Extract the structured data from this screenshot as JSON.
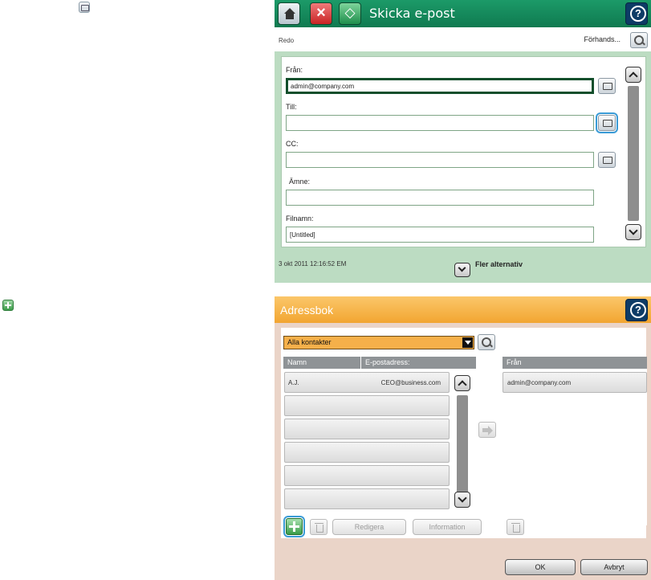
{
  "email": {
    "title": "Skicka e-post",
    "status": "Redo",
    "preview_label": "Förhands...",
    "from_label": "Från:",
    "from_value": "admin@company.com",
    "to_label": "Till:",
    "to_value": "",
    "cc_label": "CC:",
    "cc_value": "",
    "subject_label": "Ämne:",
    "subject_value": "",
    "filename_label": "Filnamn:",
    "filename_value": "[Untitled]",
    "timestamp": "3 okt 2011 12:16:52 EM",
    "more_options_label": "Fler alternativ"
  },
  "addressbook": {
    "title": "Adressbok",
    "filter_value": "Alla kontakter",
    "columns": {
      "name": "Namn",
      "email": "E-postadress:",
      "from": "Från"
    },
    "contacts": [
      {
        "name": "A.J.",
        "email": "CEO@business.com"
      },
      {
        "name": "",
        "email": ""
      },
      {
        "name": "",
        "email": ""
      },
      {
        "name": "",
        "email": ""
      },
      {
        "name": "",
        "email": ""
      },
      {
        "name": "",
        "email": ""
      }
    ],
    "from_entries": [
      "admin@company.com"
    ],
    "edit_label": "Redigera",
    "info_label": "Information",
    "ok_label": "OK",
    "cancel_label": "Avbryt"
  },
  "colors": {
    "email_titlebar": "#149063",
    "email_frame": "#bcdcc2",
    "addressbook_titlebar": "#f5b04a",
    "addressbook_frame": "#ead4c8",
    "highlight": "#3a9bd6"
  },
  "icons": [
    "home-icon",
    "stop-icon",
    "start-icon",
    "help-icon",
    "search-icon",
    "address-book-icon",
    "scroll-up-icon",
    "scroll-down-icon",
    "add-contact-icon",
    "trash-icon",
    "move-right-icon"
  ]
}
